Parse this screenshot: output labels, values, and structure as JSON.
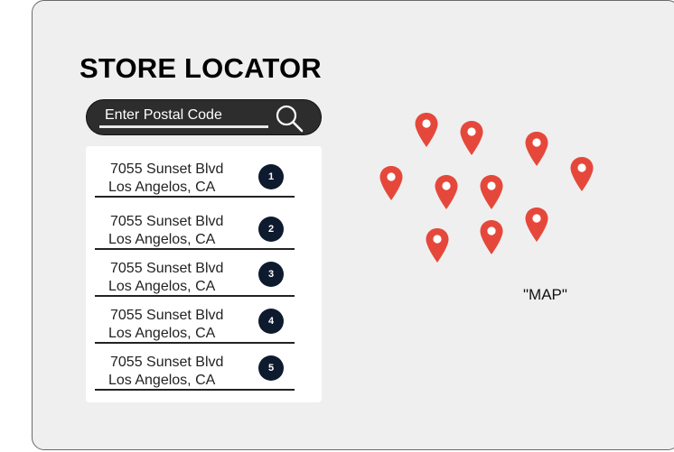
{
  "header": {
    "title": "STORE LOCATOR"
  },
  "search": {
    "placeholder": "Enter Postal Code"
  },
  "stores": [
    {
      "number": "1",
      "address": "7055 Sunset Blvd",
      "city": "Los Angelos, CA"
    },
    {
      "number": "2",
      "address": "7055 Sunset Blvd",
      "city": "Los Angelos, CA"
    },
    {
      "number": "3",
      "address": "7055 Sunset Blvd",
      "city": "Los Angelos, CA"
    },
    {
      "number": "4",
      "address": "7055 Sunset Blvd",
      "city": "Los Angelos, CA"
    },
    {
      "number": "5",
      "address": "7055 Sunset Blvd",
      "city": "Los Angelos, CA"
    }
  ],
  "map": {
    "label": "\"MAP\"",
    "pin_color": "#e5483b",
    "pin_count": 10
  },
  "icons": {
    "search": "search-icon",
    "pin": "map-pin-icon"
  },
  "colors": {
    "badge": "#0e1a2e",
    "search_bar": "#2d2d2d",
    "panel": "#efefef"
  }
}
